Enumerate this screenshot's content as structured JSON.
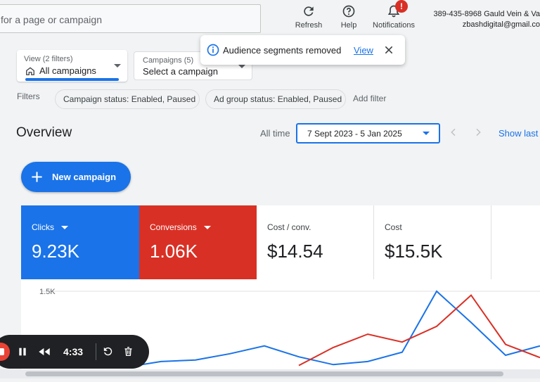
{
  "header": {
    "search_placeholder": "for a page or campaign",
    "refresh_label": "Refresh",
    "help_label": "Help",
    "notifications_label": "Notifications",
    "notifications_badge": "!",
    "account_line1": "389-435-8968 Gauld Vein & Va",
    "account_line2": "zbashdigital@gmail.co"
  },
  "selectors": {
    "view_label": "View (2 filters)",
    "view_value": "All campaigns",
    "campaigns_label": "Campaigns (5)",
    "campaigns_value": "Select a campaign"
  },
  "toast": {
    "message": "Audience segments removed",
    "action": "View"
  },
  "filters": {
    "label": "Filters",
    "chips": [
      "Campaign status: Enabled, Paused",
      "Ad group status: Enabled, Paused"
    ],
    "add_filter": "Add filter"
  },
  "overview": {
    "title": "Overview",
    "period_label": "All time",
    "date_range": "7 Sept 2023 - 5 Jan 2025",
    "show_last": "Show last"
  },
  "new_campaign_label": "New campaign",
  "metrics": [
    {
      "label": "Clicks",
      "value": "9.23K",
      "color": "#1a73e8"
    },
    {
      "label": "Conversions",
      "value": "1.06K",
      "color": "#d93025"
    },
    {
      "label": "Cost / conv.",
      "value": "$14.54"
    },
    {
      "label": "Cost",
      "value": "$15.5K"
    }
  ],
  "chart_data": {
    "type": "line",
    "y_tick_label": "1.5K",
    "series": [
      {
        "color": "#1a73e8",
        "values": [
          0.03,
          0.1,
          0.12,
          0.2,
          0.3,
          0.16,
          0.06,
          0.1,
          0.22,
          1.0,
          0.6,
          0.18,
          0.3
        ]
      },
      {
        "color": "#d93025",
        "values": [
          null,
          null,
          null,
          null,
          null,
          0.05,
          0.28,
          0.45,
          0.35,
          0.55,
          0.95,
          0.32,
          0.15
        ]
      }
    ]
  },
  "player": {
    "time": "4:33"
  }
}
